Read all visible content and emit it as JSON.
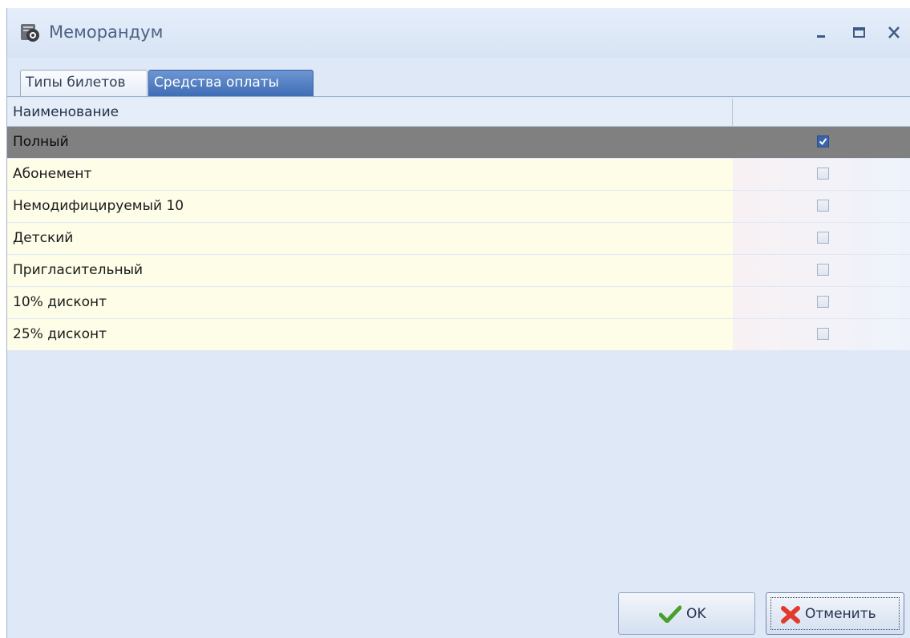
{
  "window": {
    "title": "Меморандум",
    "icon": "memorandum-app-icon"
  },
  "tabs": [
    {
      "label": "Типы билетов",
      "active": false
    },
    {
      "label": "Средства оплаты",
      "active": true
    }
  ],
  "grid": {
    "columns": [
      "Наименование",
      ""
    ],
    "rows": [
      {
        "name": "Полный",
        "checked": true,
        "selected": true
      },
      {
        "name": "Абонемент",
        "checked": false,
        "selected": false
      },
      {
        "name": "Немодифицируемый 10",
        "checked": false,
        "selected": false
      },
      {
        "name": "Детский",
        "checked": false,
        "selected": false
      },
      {
        "name": "Пригласительный",
        "checked": false,
        "selected": false
      },
      {
        "name": "10% дисконт",
        "checked": false,
        "selected": false
      },
      {
        "name": "25% дисконт",
        "checked": false,
        "selected": false
      }
    ]
  },
  "buttons": {
    "ok_label": "OK",
    "cancel_label": "Отменить"
  },
  "colors": {
    "selection": "#808080",
    "row_background": "#fefde8",
    "active_tab": "#3f6db5",
    "window_background": "#dfe8f6"
  }
}
